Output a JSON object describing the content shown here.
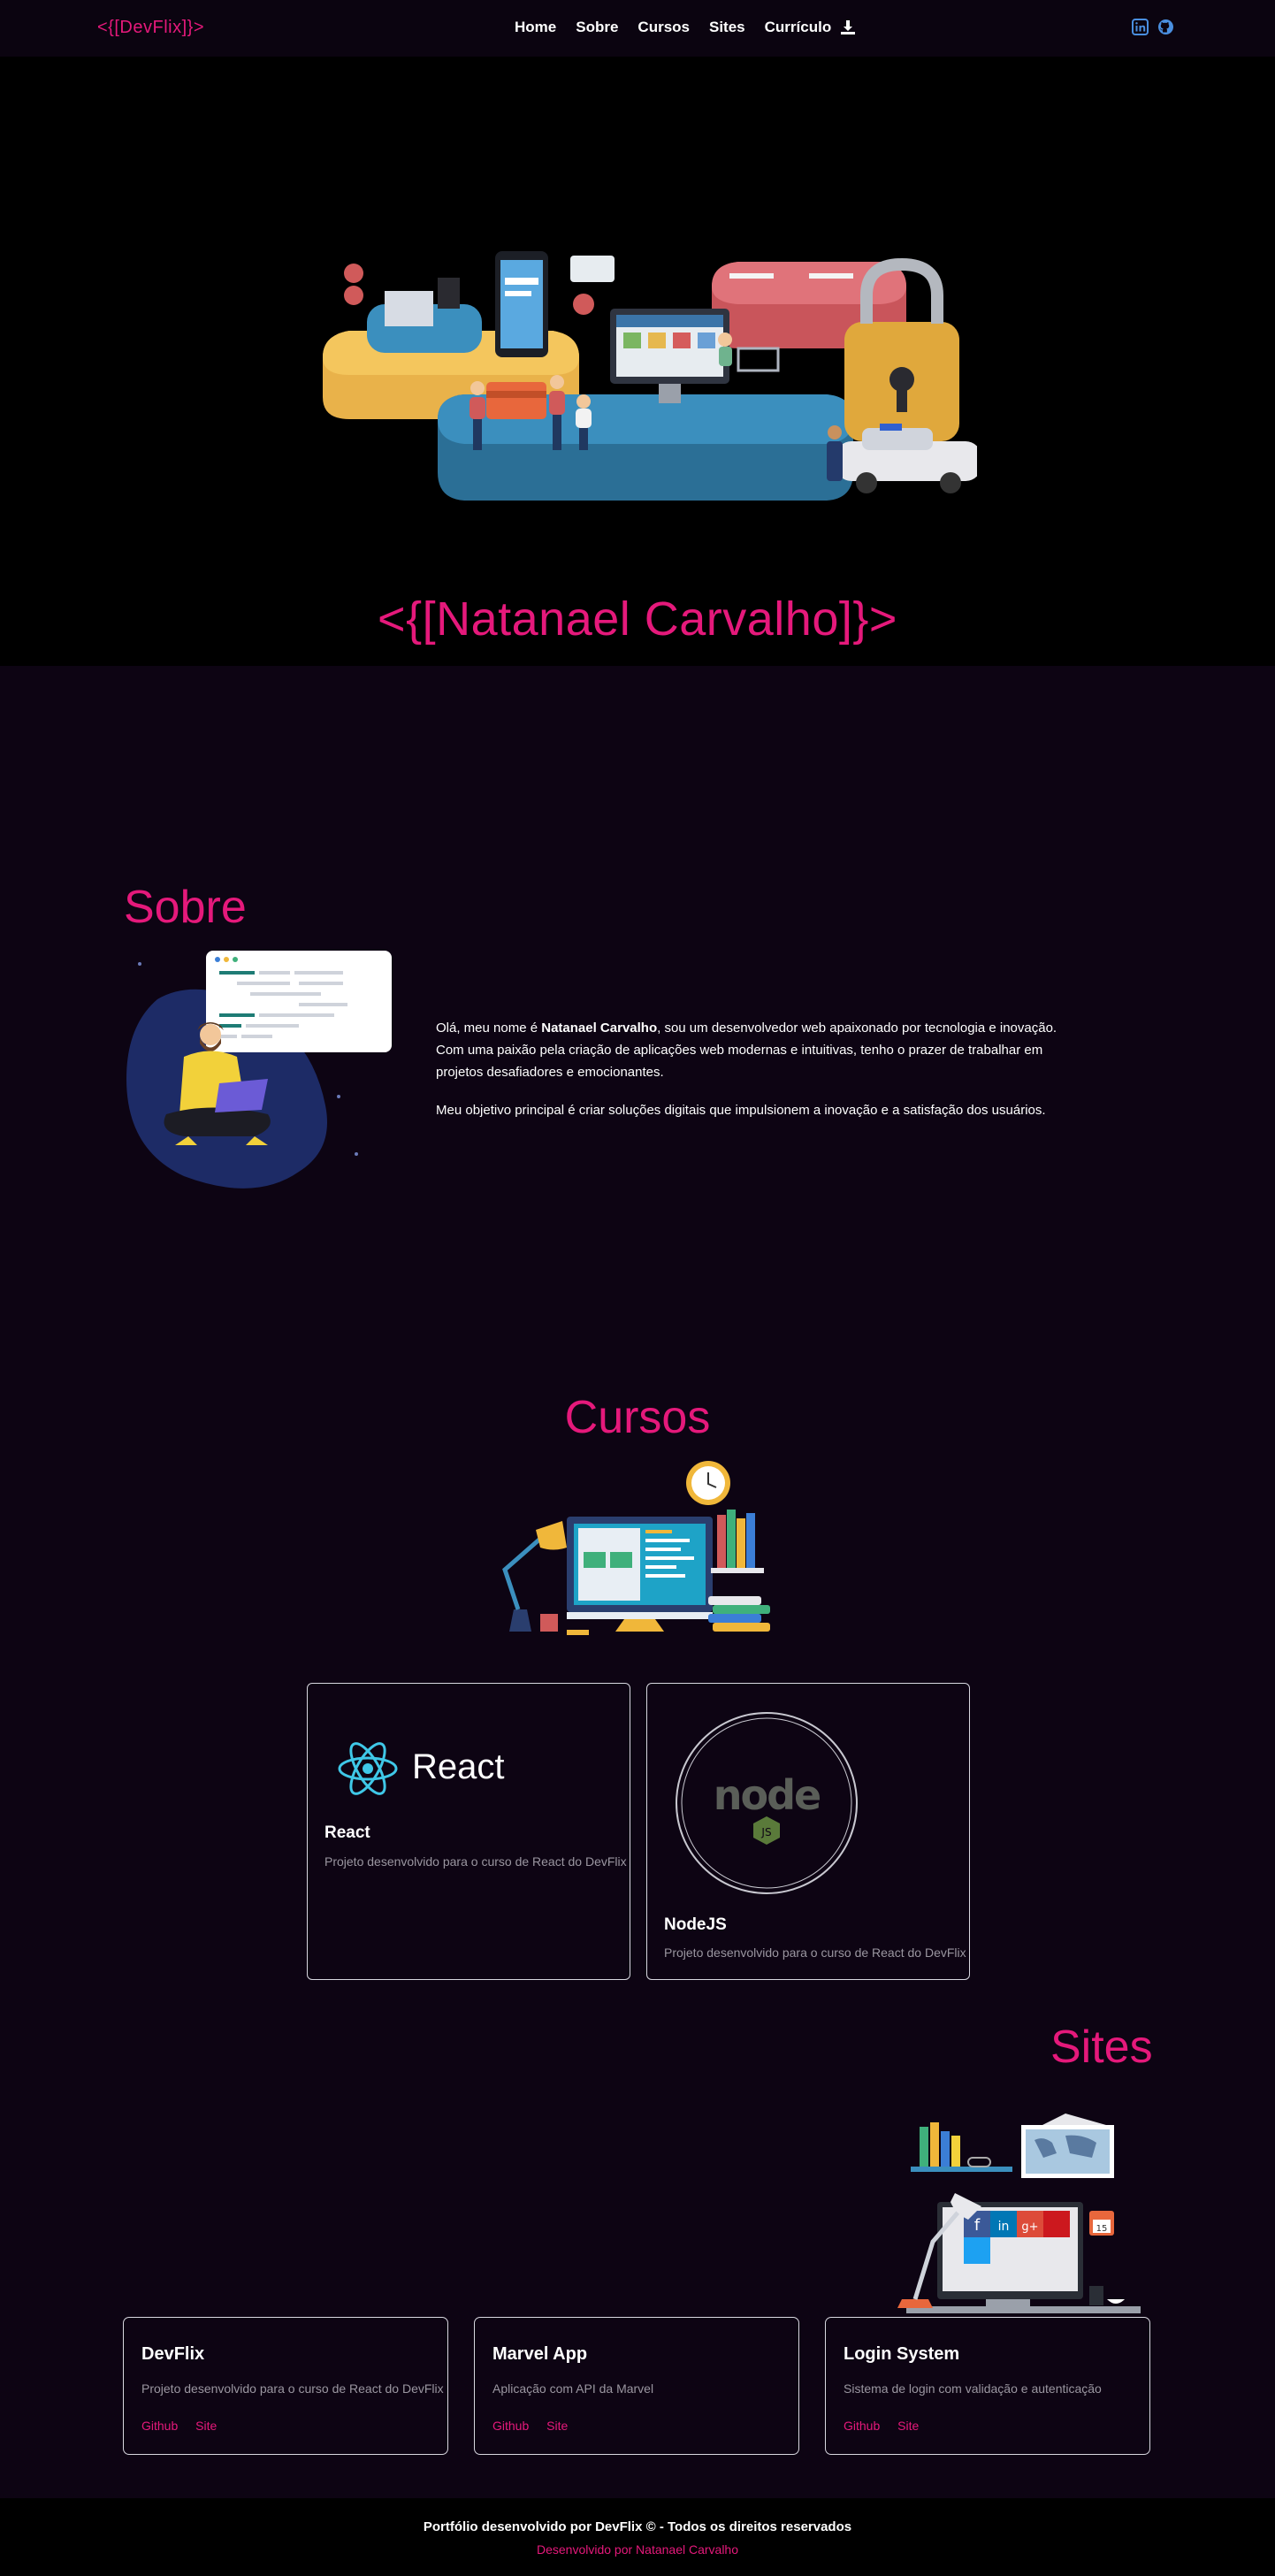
{
  "nav": {
    "logo": "<{[DevFlix]}>",
    "items": [
      "Home",
      "Sobre",
      "Cursos",
      "Sites",
      "Currículo"
    ],
    "download_icon": "download-icon",
    "social_icons": [
      "linkedin-icon",
      "github-icon"
    ]
  },
  "hero": {
    "title": "<{[Natanael Carvalho]}>"
  },
  "sobre": {
    "title": "Sobre",
    "p1_prefix": "Olá, meu nome é ",
    "p1_name": "Natanael Carvalho",
    "p1_suffix": ", sou um desenvolvedor web apaixonado por tecnologia e inovação. Com uma paixão pela criação de aplicações web modernas e intuitivas, tenho o prazer de trabalhar em projetos desafiadores e emocionantes.",
    "p2": "Meu objetivo principal é criar soluções digitais que impulsionem a inovação e a satisfação dos usuários."
  },
  "cursos": {
    "title": "Cursos",
    "items": [
      {
        "logo_text": "React",
        "name": "React",
        "desc": "Projeto desenvolvido para o curso de React do DevFlix"
      },
      {
        "logo_text": "node",
        "name": "NodeJS",
        "desc": "Projeto desenvolvido para o curso de React do DevFlix"
      }
    ]
  },
  "sites": {
    "title": "Sites",
    "items": [
      {
        "name": "DevFlix",
        "desc": "Projeto desenvolvido para o curso de React do DevFlix",
        "link1": "Github",
        "link2": "Site"
      },
      {
        "name": "Marvel App",
        "desc": "Aplicação com API da Marvel",
        "link1": "Github",
        "link2": "Site"
      },
      {
        "name": "Login System",
        "desc": "Sistema de login com validação e autenticação",
        "link1": "Github",
        "link2": "Site"
      }
    ]
  },
  "footer": {
    "line1": "Portfólio desenvolvido por DevFlix © - Todos os direitos reservados",
    "line2": "Desenvolvido por Natanael Carvalho"
  },
  "colors": {
    "accent": "#e5197b",
    "background": "#0d0413",
    "hero_bg": "#000000",
    "icon_blue": "#4a8fe0"
  }
}
